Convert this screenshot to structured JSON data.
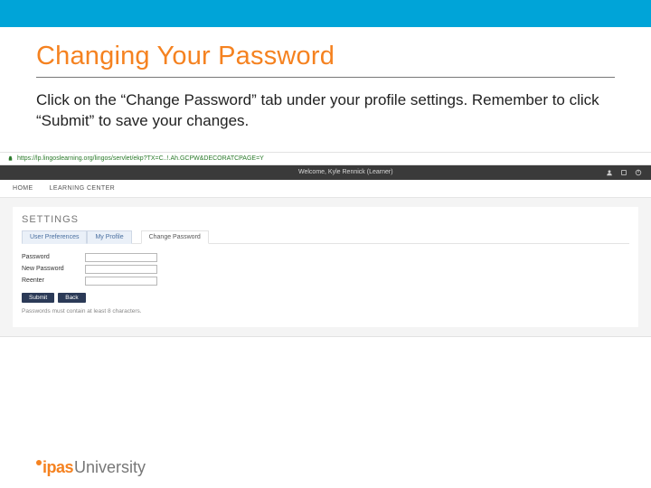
{
  "slide": {
    "title": "Changing Your Password",
    "body": "Click on the “Change Password” tab under your profile settings. Remember to click “Submit” to save your changes."
  },
  "screenshot": {
    "url": "https://lp.lingoslearning.org/lingos/servlet/ekp?TX=C..!.Ah.GCPW&DECORATCPAGE=Y",
    "welcome": "Welcome, Kyle Rennick (Learner)",
    "nav": {
      "home": "HOME",
      "learning": "LEARNING CENTER"
    },
    "settings_title": "SETTINGS",
    "tabs": {
      "prefs": "User Preferences",
      "profile": "My Profile",
      "change_pw": "Change Password"
    },
    "form": {
      "password": "Password",
      "new_password": "New Password",
      "reenter": "Reenter",
      "submit": "Submit",
      "back": "Back",
      "hint": "Passwords must contain at least 8 characters."
    }
  },
  "logo": {
    "brand": "ipas",
    "suffix": "University"
  }
}
